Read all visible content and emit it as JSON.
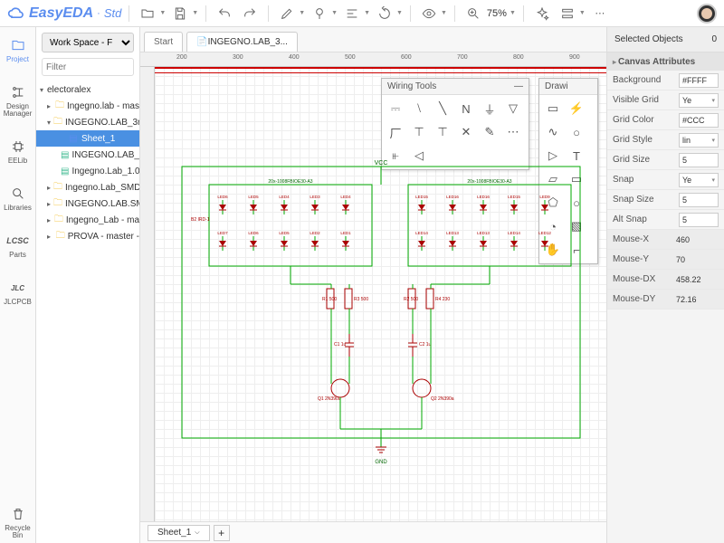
{
  "app": {
    "name": "EasyEDA",
    "edition": "Std"
  },
  "toolbar": {
    "zoom": "75%"
  },
  "rail": {
    "project": "Project",
    "design_manager": "Design\nManager",
    "eelib": "EELib",
    "libraries": "Libraries",
    "parts": "Parts",
    "jlcpcb": "JLCPCB",
    "recycle": "Recycle\nBin"
  },
  "project_panel": {
    "workspace": "Work Space - F",
    "filter_placeholder": "Filter",
    "root": "electoralex",
    "items": [
      {
        "label": "Ingegno.lab - mas",
        "type": "folder",
        "indent": 1,
        "expand": "▸"
      },
      {
        "label": "INGEGNO.LAB_3n",
        "type": "folder",
        "indent": 1,
        "expand": "▾"
      },
      {
        "label": "Sheet_1",
        "type": "sheet",
        "indent": 2,
        "selected": true
      },
      {
        "label": "INGEGNO.LAB_3",
        "type": "sheet-g",
        "indent": 2
      },
      {
        "label": "Ingegno.Lab_1.0",
        "type": "sheet-g",
        "indent": 2
      },
      {
        "label": "Ingegno.Lab_SMD",
        "type": "folder",
        "indent": 1,
        "expand": "▸"
      },
      {
        "label": "INGEGNO.LAB.SM",
        "type": "folder",
        "indent": 1,
        "expand": "▸"
      },
      {
        "label": "Ingegno_Lab - ma",
        "type": "folder",
        "indent": 1,
        "expand": "▸"
      },
      {
        "label": "PROVA - master -",
        "type": "folder",
        "indent": 1,
        "expand": "▸"
      }
    ]
  },
  "tabs": {
    "start": "Start",
    "active": "INGEGNO.LAB_3..."
  },
  "ruler": [
    "200",
    "300",
    "400",
    "500",
    "600",
    "700",
    "800",
    "900"
  ],
  "wiring": {
    "title": "Wiring Tools",
    "cells": [
      "⎓",
      "⧵",
      "╲",
      "N",
      "⏚",
      "▽",
      "厂",
      "⊤",
      "⊤",
      "✕",
      "✎",
      "⋯",
      "⫦",
      "◁"
    ]
  },
  "drawing": {
    "title": "Drawi",
    "cells": [
      "▭",
      "⚡",
      "∿",
      "○",
      "▷",
      "T",
      "▱",
      "▭",
      "⬠",
      "○",
      "◔",
      "▧",
      "✋",
      "⌐"
    ]
  },
  "schematic": {
    "vcc": "VCC",
    "gnd": "GND",
    "array_label_l": "20x-1008FBIOE30-A3",
    "array_label_r": "20x-1008FBIOE30-A3",
    "leds_top_l": [
      "LED6",
      "LED5",
      "LED4",
      "LED3",
      "LED4"
    ],
    "leds_bot_l": [
      "LED7",
      "LED6",
      "LED5",
      "LED2",
      "LED1"
    ],
    "leds_top_r": [
      "LED15",
      "LED16",
      "LED16",
      "LED15",
      "LED9"
    ],
    "leds_bot_r": [
      "LED14",
      "LED13",
      "LED13",
      "LED14",
      "LED12"
    ],
    "b2": "B2\nIRD-1",
    "r1": "R1\n500",
    "r3": "R3\n500",
    "r2": "R2\n500",
    "r4": "R4\n230",
    "c1": "C1\n1u",
    "c2": "C2\n1u",
    "q1": "Q1\n2N390a",
    "q2": "Q2\n2N390a"
  },
  "sheet_tabs": {
    "sheet1": "Sheet_1"
  },
  "right": {
    "selected_label": "Selected Objects",
    "selected_count": "0",
    "canvas_attrs": "Canvas Attributes",
    "rows": {
      "background": {
        "label": "Background",
        "value": "#FFFF"
      },
      "visible_grid": {
        "label": "Visible Grid",
        "value": "Ye"
      },
      "grid_color": {
        "label": "Grid Color",
        "value": "#CCC"
      },
      "grid_style": {
        "label": "Grid Style",
        "value": "lin"
      },
      "grid_size": {
        "label": "Grid Size",
        "value": "5"
      },
      "snap": {
        "label": "Snap",
        "value": "Ye"
      },
      "snap_size": {
        "label": "Snap Size",
        "value": "5"
      },
      "alt_snap": {
        "label": "Alt Snap",
        "value": "5"
      }
    },
    "mouse": {
      "x": {
        "label": "Mouse-X",
        "value": "460"
      },
      "y": {
        "label": "Mouse-Y",
        "value": "70"
      },
      "dx": {
        "label": "Mouse-DX",
        "value": "458.22"
      },
      "dy": {
        "label": "Mouse-DY",
        "value": "72.16"
      }
    }
  }
}
